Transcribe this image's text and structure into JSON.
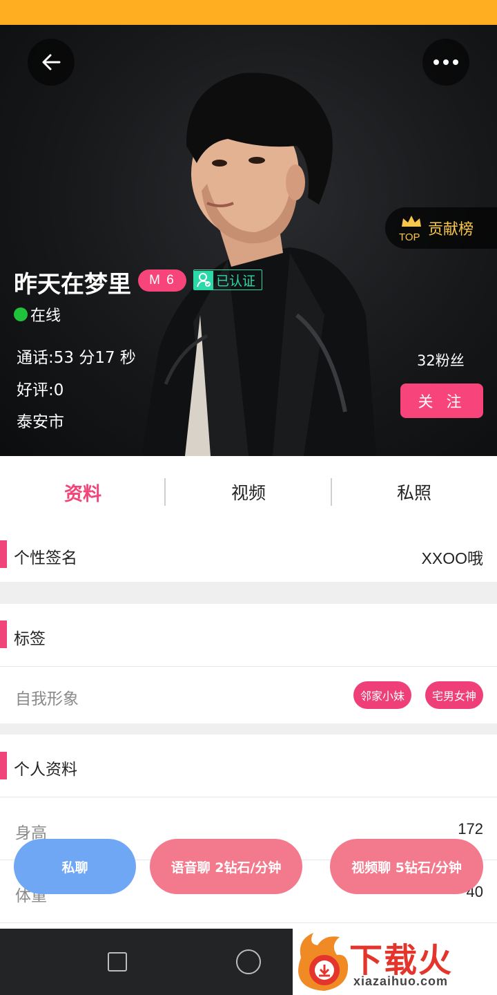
{
  "header": {
    "back_icon": "arrow-left-icon",
    "more_icon": "more-horizontal-icon"
  },
  "rank": {
    "top_label": "TOP",
    "label": "贡献榜",
    "icon": "crown-icon",
    "color": "#f7c64b"
  },
  "profile": {
    "name": "昨天在梦里",
    "level": "M 6",
    "verified_label": "已认证",
    "status": "在线",
    "call_time": "通话:53 分17 秒",
    "rating": "好评:0",
    "city": "泰安市",
    "fans": "32粉丝",
    "follow_label": "关 注"
  },
  "tabs": [
    {
      "label": "资料",
      "active": true
    },
    {
      "label": "视频",
      "active": false
    },
    {
      "label": "私照",
      "active": false
    }
  ],
  "signature": {
    "title": "个性签名",
    "value": "XXOO哦"
  },
  "tags_section": {
    "title": "标签",
    "row_label": "自我形象",
    "tags": [
      "邻家小妹",
      "宅男女神"
    ]
  },
  "personal": {
    "title": "个人资料",
    "rows": [
      {
        "label": "身高",
        "value": "172"
      },
      {
        "label": "体重",
        "value": "40"
      }
    ]
  },
  "actions": {
    "private_chat": "私聊",
    "voice_chat": "语音聊 2钻石/分钟",
    "video_chat": "视频聊 5钻石/分钟"
  },
  "watermark": {
    "text": "下载火",
    "sub": "xiazaihuo.com"
  },
  "colors": {
    "status_bar": "#ffae22",
    "accent": "#f0457a",
    "online": "#20c23c",
    "verified": "#2bd9a8",
    "private_button": "#70a7f5",
    "chat_button": "#f37a8d"
  }
}
